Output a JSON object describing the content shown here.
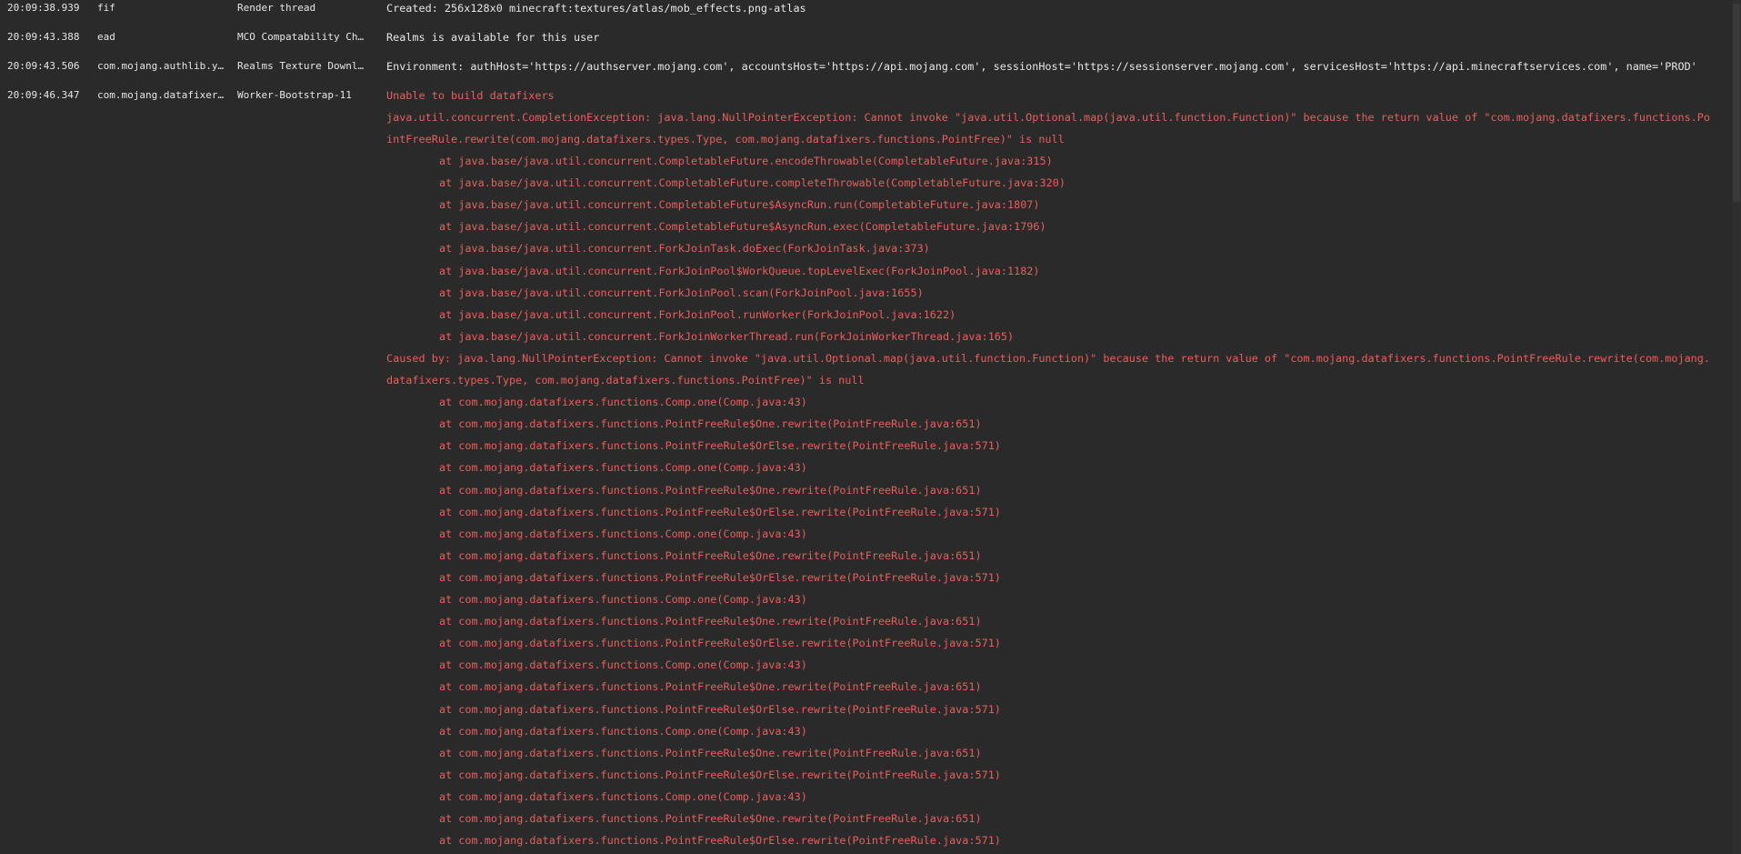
{
  "log_rows": [
    {
      "time": "20:09:38.939",
      "logger": "fif",
      "thread": "Render thread",
      "message": "Created: 256x128x0 minecraft:textures/atlas/mob_effects.png-atlas"
    },
    {
      "time": "20:09:43.388",
      "logger": "ead",
      "thread": "MCO Compatability Ch…",
      "message": "Realms is available for this user"
    },
    {
      "time": "20:09:43.506",
      "logger": "com.mojang.authlib.y…",
      "thread": "Realms Texture Downl…",
      "message": "Environment: authHost='https://authserver.mojang.com', accountsHost='https://api.mojang.com', sessionHost='https://sessionserver.mojang.com', servicesHost='https://api.minecraftservices.com', name='PROD'"
    },
    {
      "time": "20:09:46.347",
      "logger": "com.mojang.datafixer…",
      "thread": "Worker-Bootstrap-11",
      "message": "Unable to build datafixers"
    }
  ],
  "trace": {
    "exception_line1": "java.util.concurrent.CompletionException: java.lang.NullPointerException: Cannot invoke \"java.util.Optional.map(java.util.function.Function)\" because the return value of \"com.mojang.datafixers.functions.Po",
    "exception_line2": "intFreeRule.rewrite(com.mojang.datafixers.types.Type, com.mojang.datafixers.functions.PointFree)\" is null",
    "frames1": [
      "at java.base/java.util.concurrent.CompletableFuture.encodeThrowable(CompletableFuture.java:315)",
      "at java.base/java.util.concurrent.CompletableFuture.completeThrowable(CompletableFuture.java:320)",
      "at java.base/java.util.concurrent.CompletableFuture$AsyncRun.run(CompletableFuture.java:1807)",
      "at java.base/java.util.concurrent.CompletableFuture$AsyncRun.exec(CompletableFuture.java:1796)",
      "at java.base/java.util.concurrent.ForkJoinTask.doExec(ForkJoinTask.java:373)",
      "at java.base/java.util.concurrent.ForkJoinPool$WorkQueue.topLevelExec(ForkJoinPool.java:1182)",
      "at java.base/java.util.concurrent.ForkJoinPool.scan(ForkJoinPool.java:1655)",
      "at java.base/java.util.concurrent.ForkJoinPool.runWorker(ForkJoinPool.java:1622)",
      "at java.base/java.util.concurrent.ForkJoinWorkerThread.run(ForkJoinWorkerThread.java:165)"
    ],
    "caused_line1": "Caused by: java.lang.NullPointerException: Cannot invoke \"java.util.Optional.map(java.util.function.Function)\" because the return value of \"com.mojang.datafixers.functions.PointFreeRule.rewrite(com.mojang.",
    "caused_line2": "datafixers.types.Type, com.mojang.datafixers.functions.PointFree)\" is null",
    "frames2": [
      "at com.mojang.datafixers.functions.Comp.one(Comp.java:43)",
      "at com.mojang.datafixers.functions.PointFreeRule$One.rewrite(PointFreeRule.java:651)",
      "at com.mojang.datafixers.functions.PointFreeRule$OrElse.rewrite(PointFreeRule.java:571)",
      "at com.mojang.datafixers.functions.Comp.one(Comp.java:43)",
      "at com.mojang.datafixers.functions.PointFreeRule$One.rewrite(PointFreeRule.java:651)",
      "at com.mojang.datafixers.functions.PointFreeRule$OrElse.rewrite(PointFreeRule.java:571)",
      "at com.mojang.datafixers.functions.Comp.one(Comp.java:43)",
      "at com.mojang.datafixers.functions.PointFreeRule$One.rewrite(PointFreeRule.java:651)",
      "at com.mojang.datafixers.functions.PointFreeRule$OrElse.rewrite(PointFreeRule.java:571)",
      "at com.mojang.datafixers.functions.Comp.one(Comp.java:43)",
      "at com.mojang.datafixers.functions.PointFreeRule$One.rewrite(PointFreeRule.java:651)",
      "at com.mojang.datafixers.functions.PointFreeRule$OrElse.rewrite(PointFreeRule.java:571)",
      "at com.mojang.datafixers.functions.Comp.one(Comp.java:43)",
      "at com.mojang.datafixers.functions.PointFreeRule$One.rewrite(PointFreeRule.java:651)",
      "at com.mojang.datafixers.functions.PointFreeRule$OrElse.rewrite(PointFreeRule.java:571)",
      "at com.mojang.datafixers.functions.Comp.one(Comp.java:43)",
      "at com.mojang.datafixers.functions.PointFreeRule$One.rewrite(PointFreeRule.java:651)",
      "at com.mojang.datafixers.functions.PointFreeRule$OrElse.rewrite(PointFreeRule.java:571)",
      "at com.mojang.datafixers.functions.Comp.one(Comp.java:43)",
      "at com.mojang.datafixers.functions.PointFreeRule$One.rewrite(PointFreeRule.java:651)",
      "at com.mojang.datafixers.functions.PointFreeRule$OrElse.rewrite(PointFreeRule.java:571)"
    ]
  },
  "colors": {
    "background": "#2a2a2a",
    "text": "#e6e6e6",
    "error": "#e85f5f"
  }
}
